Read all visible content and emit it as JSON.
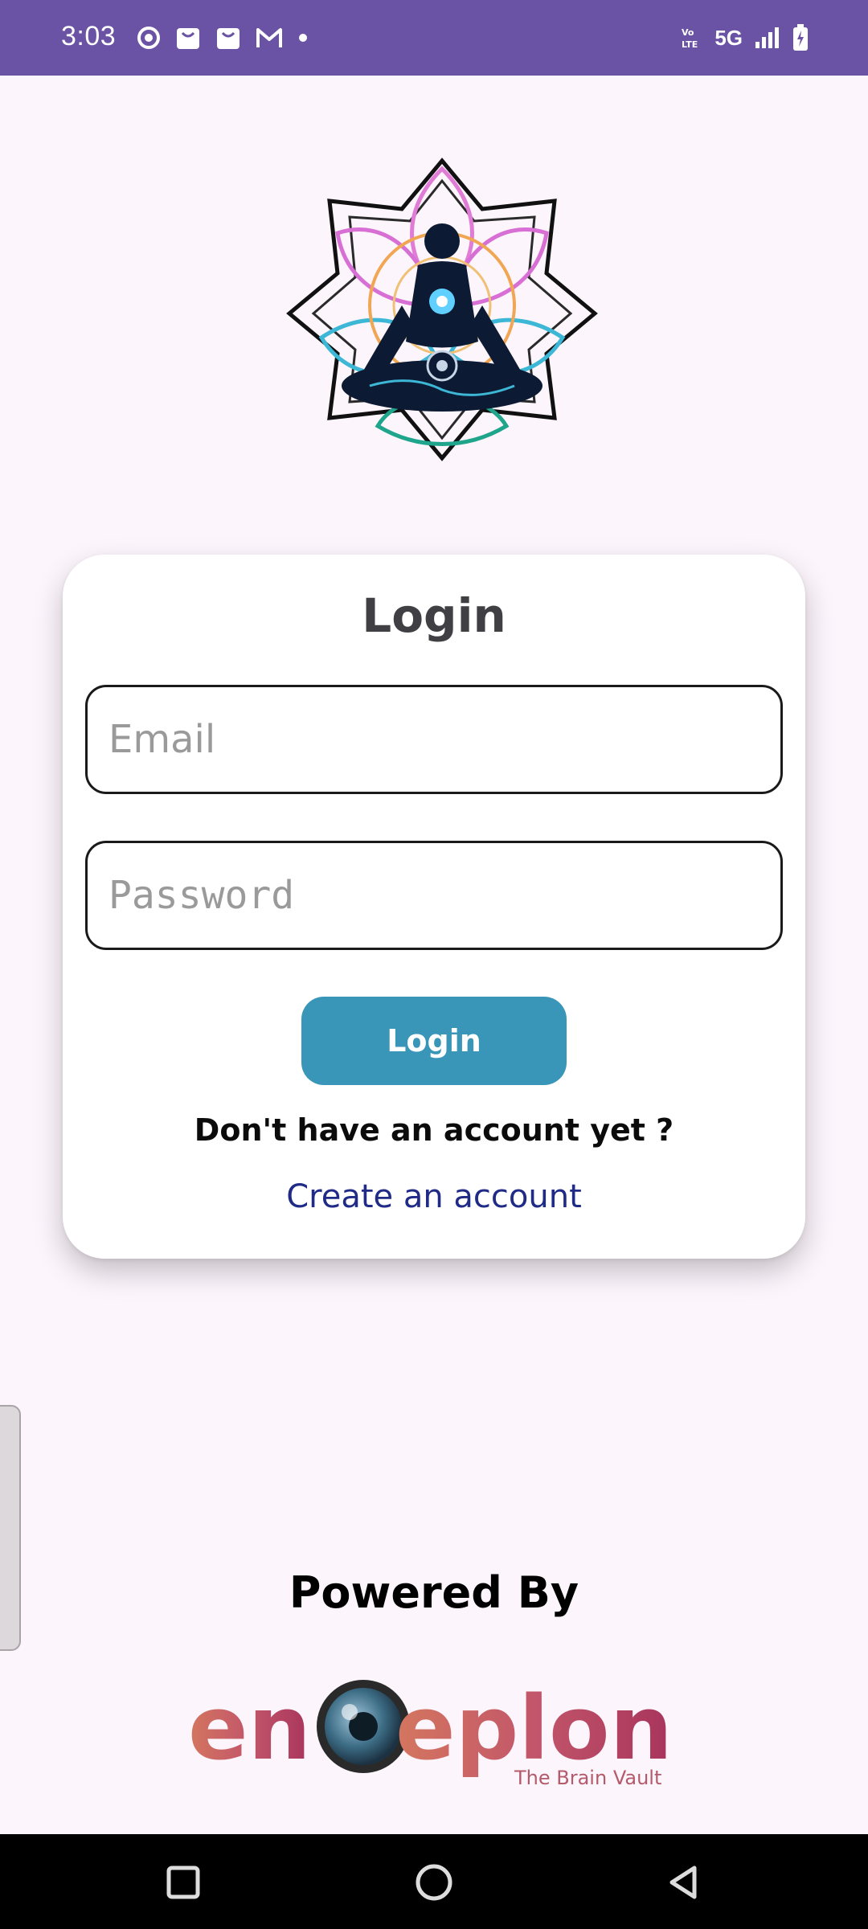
{
  "status_bar": {
    "time": "3:03",
    "network": "5G",
    "volte": "VoLTE",
    "background": "#6a52a4"
  },
  "card": {
    "title": "Login",
    "email_placeholder": "Email",
    "email_value": "",
    "password_placeholder": "Password",
    "password_value": "",
    "login_button_label": "Login",
    "no_account_text": "Don't have an account yet ?",
    "create_account_link": "Create an account"
  },
  "footer": {
    "powered_by": "Powered By",
    "brand_name": "enceplon",
    "brand_tagline": "The Brain Vault"
  },
  "colors": {
    "accent_button": "#3a96b8",
    "link": "#1f2b86",
    "background": "#fcf5fc"
  },
  "icons": {
    "logo": "meditation-mandala-logo",
    "nav_recents": "square-recents-icon",
    "nav_home": "circle-home-icon",
    "nav_back": "triangle-back-icon"
  }
}
